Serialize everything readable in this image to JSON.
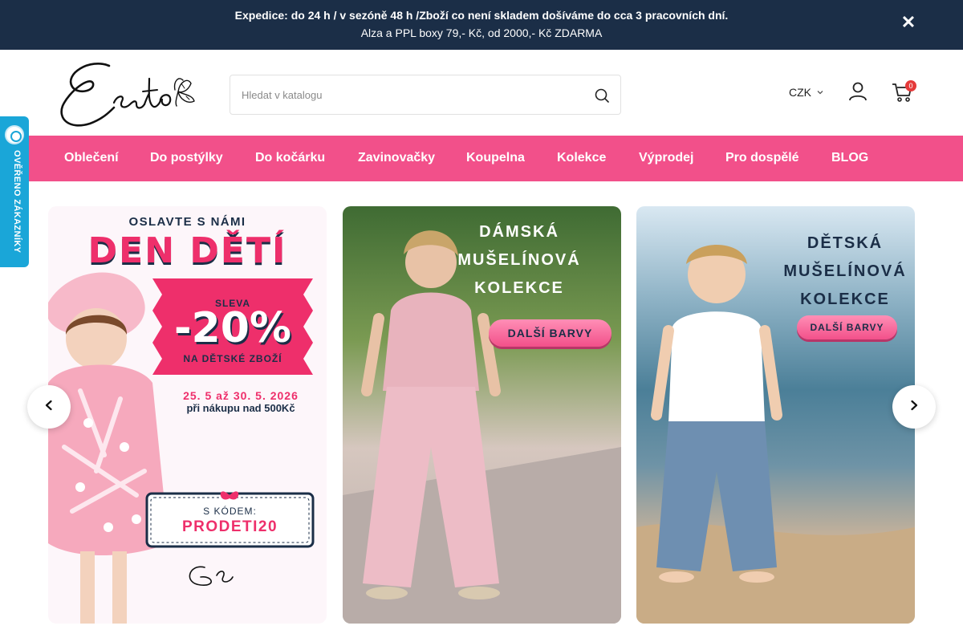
{
  "topbar": {
    "line1": "Expedice: do 24 h / v sezóně 48 h /Zboží co není skladem došíváme do cca 3 pracovních dní.",
    "line2": "Alza a PPL boxy 79,- Kč, od 2000,- Kč ZDARMA",
    "close_label": "✕"
  },
  "header": {
    "logo_text": "Esito",
    "search_placeholder": "Hledat v katalogu",
    "currency": "CZK",
    "cart_count": "0"
  },
  "nav": {
    "items": [
      "Oblečení",
      "Do postýlky",
      "Do kočárku",
      "Zavinovačky",
      "Koupelna",
      "Kolekce",
      "Výprodej",
      "Pro dospělé",
      "BLOG"
    ]
  },
  "badge": {
    "text": "OVĚŘENO ZÁKAZNÍKY"
  },
  "banners": {
    "b1": {
      "kicker": "OSLAVTE S NÁMI",
      "title": "DEN DĚTÍ",
      "sale_label": "SLEVA",
      "discount": "-20%",
      "discount_note": "NA DĚTSKÉ ZBOŽÍ",
      "dates": "25. 5 až 30. 5. 2026",
      "condition": "při nákupu nad 500Kč",
      "code_label": "S KÓDEM:",
      "code": "PRODETI20",
      "logo_text": "Esito"
    },
    "b2": {
      "line1": "DÁMSKÁ",
      "line2": "MUŠELÍNOVÁ",
      "line3": "KOLEKCE",
      "button": "DALŠÍ BARVY"
    },
    "b3": {
      "line1": "DĚTSKÁ",
      "line2": "MUŠELÍNOVÁ",
      "line3": "KOLEKCE",
      "button": "DALŠÍ BARVY"
    }
  },
  "colors": {
    "topbar": "#1b2e47",
    "nav": "#f2508a",
    "badge": "#1aa6d8",
    "cart_badge": "#e53a3a"
  },
  "icons": {
    "search": "search-icon",
    "account": "user-icon",
    "cart": "cart-icon",
    "prev": "chevron-left-icon",
    "next": "chevron-right-icon",
    "close": "close-icon"
  }
}
